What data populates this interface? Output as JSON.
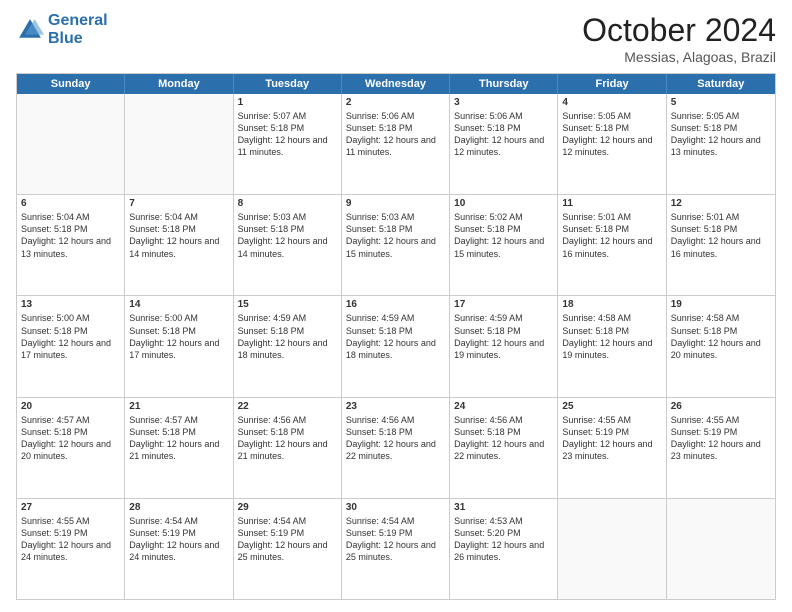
{
  "logo": {
    "line1": "General",
    "line2": "Blue"
  },
  "title": "October 2024",
  "location": "Messias, Alagoas, Brazil",
  "header_days": [
    "Sunday",
    "Monday",
    "Tuesday",
    "Wednesday",
    "Thursday",
    "Friday",
    "Saturday"
  ],
  "weeks": [
    [
      {
        "day": "",
        "sunrise": "",
        "sunset": "",
        "daylight": ""
      },
      {
        "day": "",
        "sunrise": "",
        "sunset": "",
        "daylight": ""
      },
      {
        "day": "1",
        "sunrise": "Sunrise: 5:07 AM",
        "sunset": "Sunset: 5:18 PM",
        "daylight": "Daylight: 12 hours and 11 minutes."
      },
      {
        "day": "2",
        "sunrise": "Sunrise: 5:06 AM",
        "sunset": "Sunset: 5:18 PM",
        "daylight": "Daylight: 12 hours and 11 minutes."
      },
      {
        "day": "3",
        "sunrise": "Sunrise: 5:06 AM",
        "sunset": "Sunset: 5:18 PM",
        "daylight": "Daylight: 12 hours and 12 minutes."
      },
      {
        "day": "4",
        "sunrise": "Sunrise: 5:05 AM",
        "sunset": "Sunset: 5:18 PM",
        "daylight": "Daylight: 12 hours and 12 minutes."
      },
      {
        "day": "5",
        "sunrise": "Sunrise: 5:05 AM",
        "sunset": "Sunset: 5:18 PM",
        "daylight": "Daylight: 12 hours and 13 minutes."
      }
    ],
    [
      {
        "day": "6",
        "sunrise": "Sunrise: 5:04 AM",
        "sunset": "Sunset: 5:18 PM",
        "daylight": "Daylight: 12 hours and 13 minutes."
      },
      {
        "day": "7",
        "sunrise": "Sunrise: 5:04 AM",
        "sunset": "Sunset: 5:18 PM",
        "daylight": "Daylight: 12 hours and 14 minutes."
      },
      {
        "day": "8",
        "sunrise": "Sunrise: 5:03 AM",
        "sunset": "Sunset: 5:18 PM",
        "daylight": "Daylight: 12 hours and 14 minutes."
      },
      {
        "day": "9",
        "sunrise": "Sunrise: 5:03 AM",
        "sunset": "Sunset: 5:18 PM",
        "daylight": "Daylight: 12 hours and 15 minutes."
      },
      {
        "day": "10",
        "sunrise": "Sunrise: 5:02 AM",
        "sunset": "Sunset: 5:18 PM",
        "daylight": "Daylight: 12 hours and 15 minutes."
      },
      {
        "day": "11",
        "sunrise": "Sunrise: 5:01 AM",
        "sunset": "Sunset: 5:18 PM",
        "daylight": "Daylight: 12 hours and 16 minutes."
      },
      {
        "day": "12",
        "sunrise": "Sunrise: 5:01 AM",
        "sunset": "Sunset: 5:18 PM",
        "daylight": "Daylight: 12 hours and 16 minutes."
      }
    ],
    [
      {
        "day": "13",
        "sunrise": "Sunrise: 5:00 AM",
        "sunset": "Sunset: 5:18 PM",
        "daylight": "Daylight: 12 hours and 17 minutes."
      },
      {
        "day": "14",
        "sunrise": "Sunrise: 5:00 AM",
        "sunset": "Sunset: 5:18 PM",
        "daylight": "Daylight: 12 hours and 17 minutes."
      },
      {
        "day": "15",
        "sunrise": "Sunrise: 4:59 AM",
        "sunset": "Sunset: 5:18 PM",
        "daylight": "Daylight: 12 hours and 18 minutes."
      },
      {
        "day": "16",
        "sunrise": "Sunrise: 4:59 AM",
        "sunset": "Sunset: 5:18 PM",
        "daylight": "Daylight: 12 hours and 18 minutes."
      },
      {
        "day": "17",
        "sunrise": "Sunrise: 4:59 AM",
        "sunset": "Sunset: 5:18 PM",
        "daylight": "Daylight: 12 hours and 19 minutes."
      },
      {
        "day": "18",
        "sunrise": "Sunrise: 4:58 AM",
        "sunset": "Sunset: 5:18 PM",
        "daylight": "Daylight: 12 hours and 19 minutes."
      },
      {
        "day": "19",
        "sunrise": "Sunrise: 4:58 AM",
        "sunset": "Sunset: 5:18 PM",
        "daylight": "Daylight: 12 hours and 20 minutes."
      }
    ],
    [
      {
        "day": "20",
        "sunrise": "Sunrise: 4:57 AM",
        "sunset": "Sunset: 5:18 PM",
        "daylight": "Daylight: 12 hours and 20 minutes."
      },
      {
        "day": "21",
        "sunrise": "Sunrise: 4:57 AM",
        "sunset": "Sunset: 5:18 PM",
        "daylight": "Daylight: 12 hours and 21 minutes."
      },
      {
        "day": "22",
        "sunrise": "Sunrise: 4:56 AM",
        "sunset": "Sunset: 5:18 PM",
        "daylight": "Daylight: 12 hours and 21 minutes."
      },
      {
        "day": "23",
        "sunrise": "Sunrise: 4:56 AM",
        "sunset": "Sunset: 5:18 PM",
        "daylight": "Daylight: 12 hours and 22 minutes."
      },
      {
        "day": "24",
        "sunrise": "Sunrise: 4:56 AM",
        "sunset": "Sunset: 5:18 PM",
        "daylight": "Daylight: 12 hours and 22 minutes."
      },
      {
        "day": "25",
        "sunrise": "Sunrise: 4:55 AM",
        "sunset": "Sunset: 5:19 PM",
        "daylight": "Daylight: 12 hours and 23 minutes."
      },
      {
        "day": "26",
        "sunrise": "Sunrise: 4:55 AM",
        "sunset": "Sunset: 5:19 PM",
        "daylight": "Daylight: 12 hours and 23 minutes."
      }
    ],
    [
      {
        "day": "27",
        "sunrise": "Sunrise: 4:55 AM",
        "sunset": "Sunset: 5:19 PM",
        "daylight": "Daylight: 12 hours and 24 minutes."
      },
      {
        "day": "28",
        "sunrise": "Sunrise: 4:54 AM",
        "sunset": "Sunset: 5:19 PM",
        "daylight": "Daylight: 12 hours and 24 minutes."
      },
      {
        "day": "29",
        "sunrise": "Sunrise: 4:54 AM",
        "sunset": "Sunset: 5:19 PM",
        "daylight": "Daylight: 12 hours and 25 minutes."
      },
      {
        "day": "30",
        "sunrise": "Sunrise: 4:54 AM",
        "sunset": "Sunset: 5:19 PM",
        "daylight": "Daylight: 12 hours and 25 minutes."
      },
      {
        "day": "31",
        "sunrise": "Sunrise: 4:53 AM",
        "sunset": "Sunset: 5:20 PM",
        "daylight": "Daylight: 12 hours and 26 minutes."
      },
      {
        "day": "",
        "sunrise": "",
        "sunset": "",
        "daylight": ""
      },
      {
        "day": "",
        "sunrise": "",
        "sunset": "",
        "daylight": ""
      }
    ]
  ]
}
